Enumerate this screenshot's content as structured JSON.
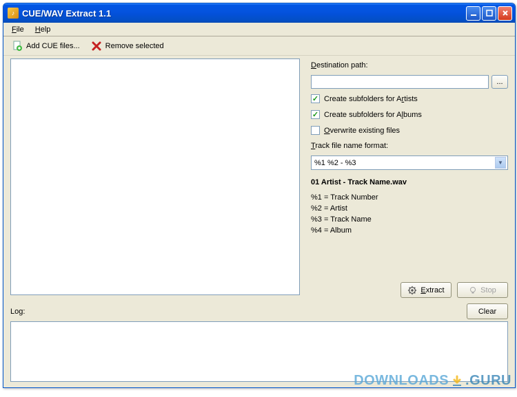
{
  "window": {
    "title": "CUE/WAV Extract 1.1"
  },
  "menu": {
    "file": "File",
    "help": "Help"
  },
  "toolbar": {
    "add_label": "Add CUE files...",
    "remove_label": "Remove selected"
  },
  "options": {
    "dest_label": "Destination path:",
    "dest_value": "",
    "browse": "...",
    "create_artists": {
      "checked": true,
      "label": "Create subfolders for Artists"
    },
    "create_albums": {
      "checked": true,
      "label": "Create subfolders for Albums"
    },
    "overwrite": {
      "checked": false,
      "label": "Overwrite existing files"
    },
    "format_label": "Track file name format:",
    "format_value": "%1 %2 - %3",
    "example": "01 Artist - Track Name.wav",
    "legend": {
      "l1": "%1 = Track Number",
      "l2": "%2 = Artist",
      "l3": "%3 = Track Name",
      "l4": "%4 = Album"
    }
  },
  "actions": {
    "extract": "Extract",
    "stop": "Stop"
  },
  "log": {
    "label": "Log:",
    "clear": "Clear"
  },
  "watermark": {
    "a": "DOWNLOADS",
    "b": ".GURU"
  },
  "icons": {
    "app": "app-icon",
    "minimize": "minimize-icon",
    "maximize": "maximize-icon",
    "close": "close-icon",
    "add": "page-add-icon",
    "remove": "x-remove-icon",
    "gear": "gear-icon",
    "bulb": "lightbulb-icon",
    "dropdown": "chevron-down-icon"
  }
}
